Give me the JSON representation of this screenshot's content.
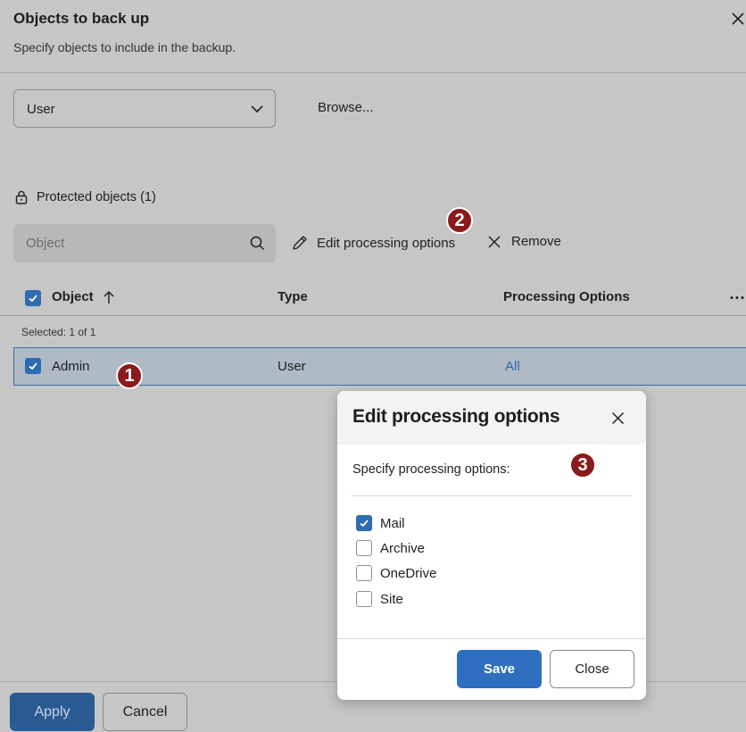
{
  "header": {
    "title": "Objects to back up",
    "subtitle": "Specify objects to include in the backup."
  },
  "object_type_select": {
    "value": "User"
  },
  "browse_label": "Browse...",
  "protected_label": "Protected objects (1)",
  "search": {
    "placeholder": "Object"
  },
  "toolbar": {
    "edit_label": "Edit processing options",
    "remove_label": "Remove"
  },
  "table": {
    "columns": [
      "Object",
      "Type",
      "Processing Options"
    ],
    "selected_info": "Selected: 1 of 1",
    "rows": [
      {
        "object": "Admin",
        "type": "User",
        "processing": "All",
        "checked": true
      }
    ]
  },
  "badges": [
    "1",
    "2",
    "3"
  ],
  "footer": {
    "apply_label": "Apply",
    "cancel_label": "Cancel"
  },
  "dialog": {
    "title": "Edit processing options",
    "instruction": "Specify processing options:",
    "options": [
      {
        "label": "Mail",
        "checked": true
      },
      {
        "label": "Archive",
        "checked": false
      },
      {
        "label": "OneDrive",
        "checked": false
      },
      {
        "label": "Site",
        "checked": false
      }
    ],
    "save_label": "Save",
    "close_label": "Close"
  },
  "colors": {
    "accent": "#2e6bb0",
    "badge": "#8b1a1a",
    "overlay": "#c6c6c6"
  }
}
